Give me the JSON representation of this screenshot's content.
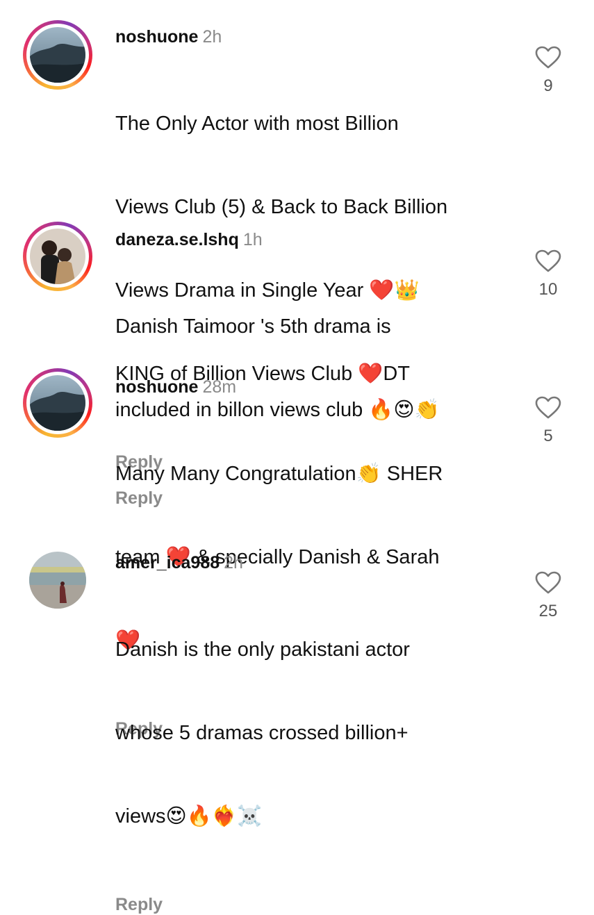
{
  "comments": [
    {
      "username": "noshuone",
      "time": "2h",
      "lines": [
        "The Only Actor with most Billion",
        "Views Club (5) & Back to Back Billion",
        "Views Drama in Single Year ❤️👑",
        "KING of Billion Views Club ❤️DT"
      ],
      "reply_label": "Reply",
      "likes": "9",
      "avatar": "story-ring-landscape-avatar"
    },
    {
      "username": "daneza.se.lshq",
      "time": "1h",
      "lines": [
        "Danish Taimoor 's 5th drama is",
        "included in billon views club 🔥😍👏"
      ],
      "reply_label": "Reply",
      "likes": "10",
      "avatar": "story-ring-couple-avatar"
    },
    {
      "username": "noshuone",
      "time": "28m",
      "lines": [
        "Many Many Congratulation👏 SHER",
        "team ❤️ & specially Danish & Sarah",
        "❤️"
      ],
      "reply_label": "Reply",
      "likes": "5",
      "avatar": "story-ring-landscape-avatar"
    },
    {
      "username": "amer_ica988",
      "time": "2h",
      "lines": [
        "Danish is the only pakistani actor",
        "whose 5 dramas crossed billion+",
        "views😍🔥❤️‍🔥☠️"
      ],
      "reply_label": "Reply",
      "likes": "25",
      "avatar": "beach-photo-avatar"
    }
  ],
  "colors": {
    "text": "#111111",
    "muted": "#8a8a8a",
    "like_count": "#555555",
    "story_ring": [
      "#fcaf45",
      "#f56040",
      "#e1306c",
      "#c13584",
      "#833ab4"
    ]
  },
  "icons": {
    "like": "heart-outline-icon"
  }
}
